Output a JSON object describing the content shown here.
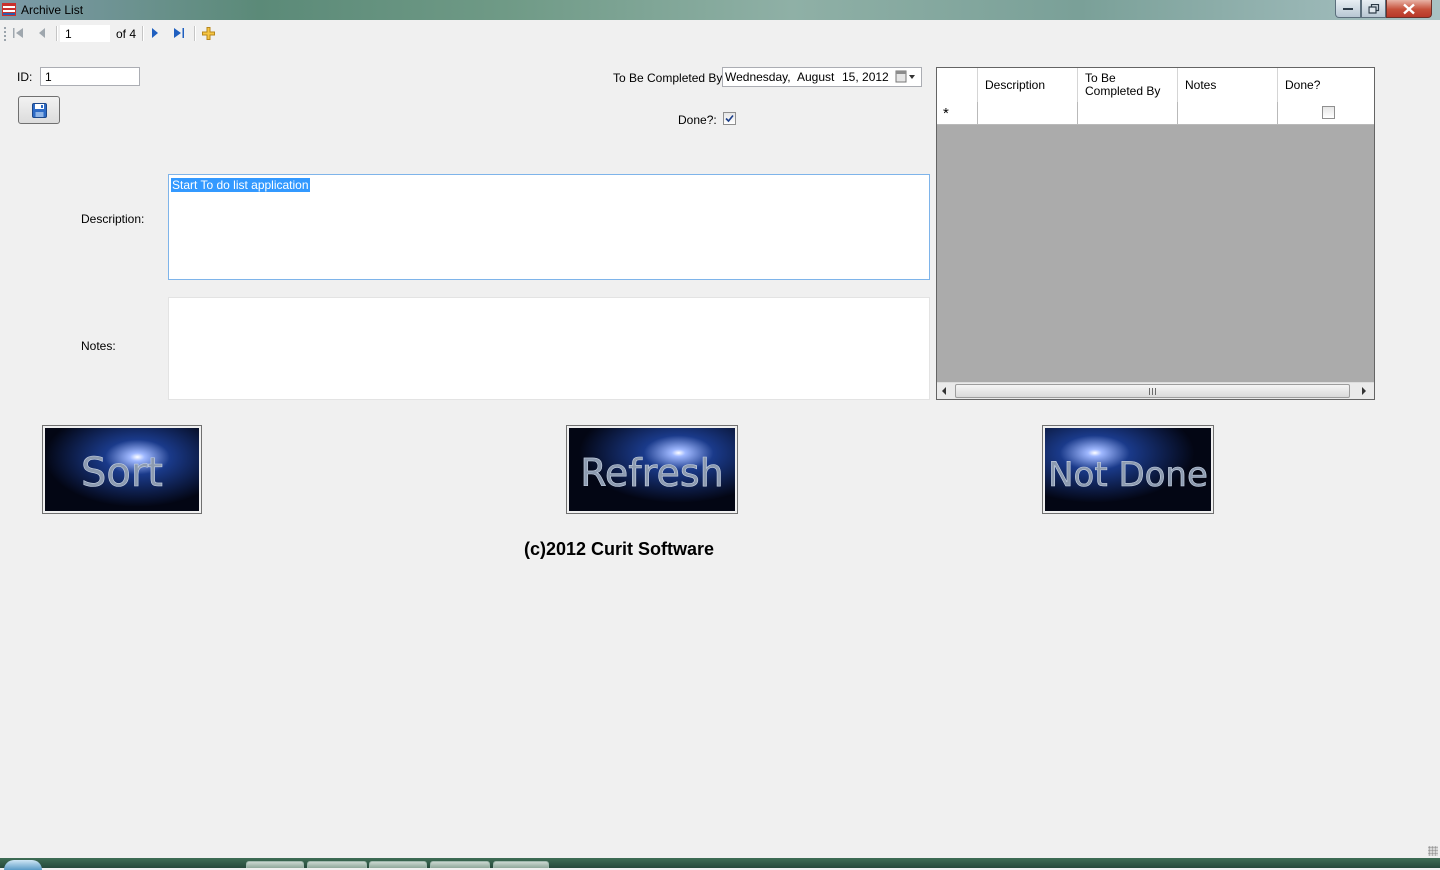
{
  "window": {
    "title": "Archive List",
    "icon": "app-icon"
  },
  "navigator": {
    "position": "1",
    "count": "of 4",
    "buttons": [
      "move-first-icon",
      "move-previous-icon",
      "move-next-icon",
      "move-last-icon",
      "add-new-icon"
    ]
  },
  "form": {
    "id_label": "ID:",
    "id_value": "1",
    "save_icon": "floppy-disk-icon",
    "due_label": "To Be Completed By:",
    "due_date": {
      "day": "Wednesday,",
      "month": "August",
      "rest": "15, 2012"
    },
    "done_label": "Done?:",
    "done_checked": true,
    "description_label": "Description:",
    "description_value": "Start To do list application",
    "notes_label": "Notes:",
    "notes_value": ""
  },
  "grid": {
    "columns": [
      {
        "label": "Description"
      },
      {
        "label": "To Be Completed By"
      },
      {
        "label": "Notes"
      },
      {
        "label": "Done?"
      }
    ],
    "new_row_marker": "*",
    "scroll_grip": "III"
  },
  "buttons": {
    "sort": "Sort",
    "refresh": "Refresh",
    "not_done": "Not Done"
  },
  "footer": {
    "copyright": "(c)2012 Curit Software"
  },
  "colors": {
    "selection": "#3399ff",
    "grid_background": "#ababab",
    "button_glow": "#1a3a8a"
  }
}
